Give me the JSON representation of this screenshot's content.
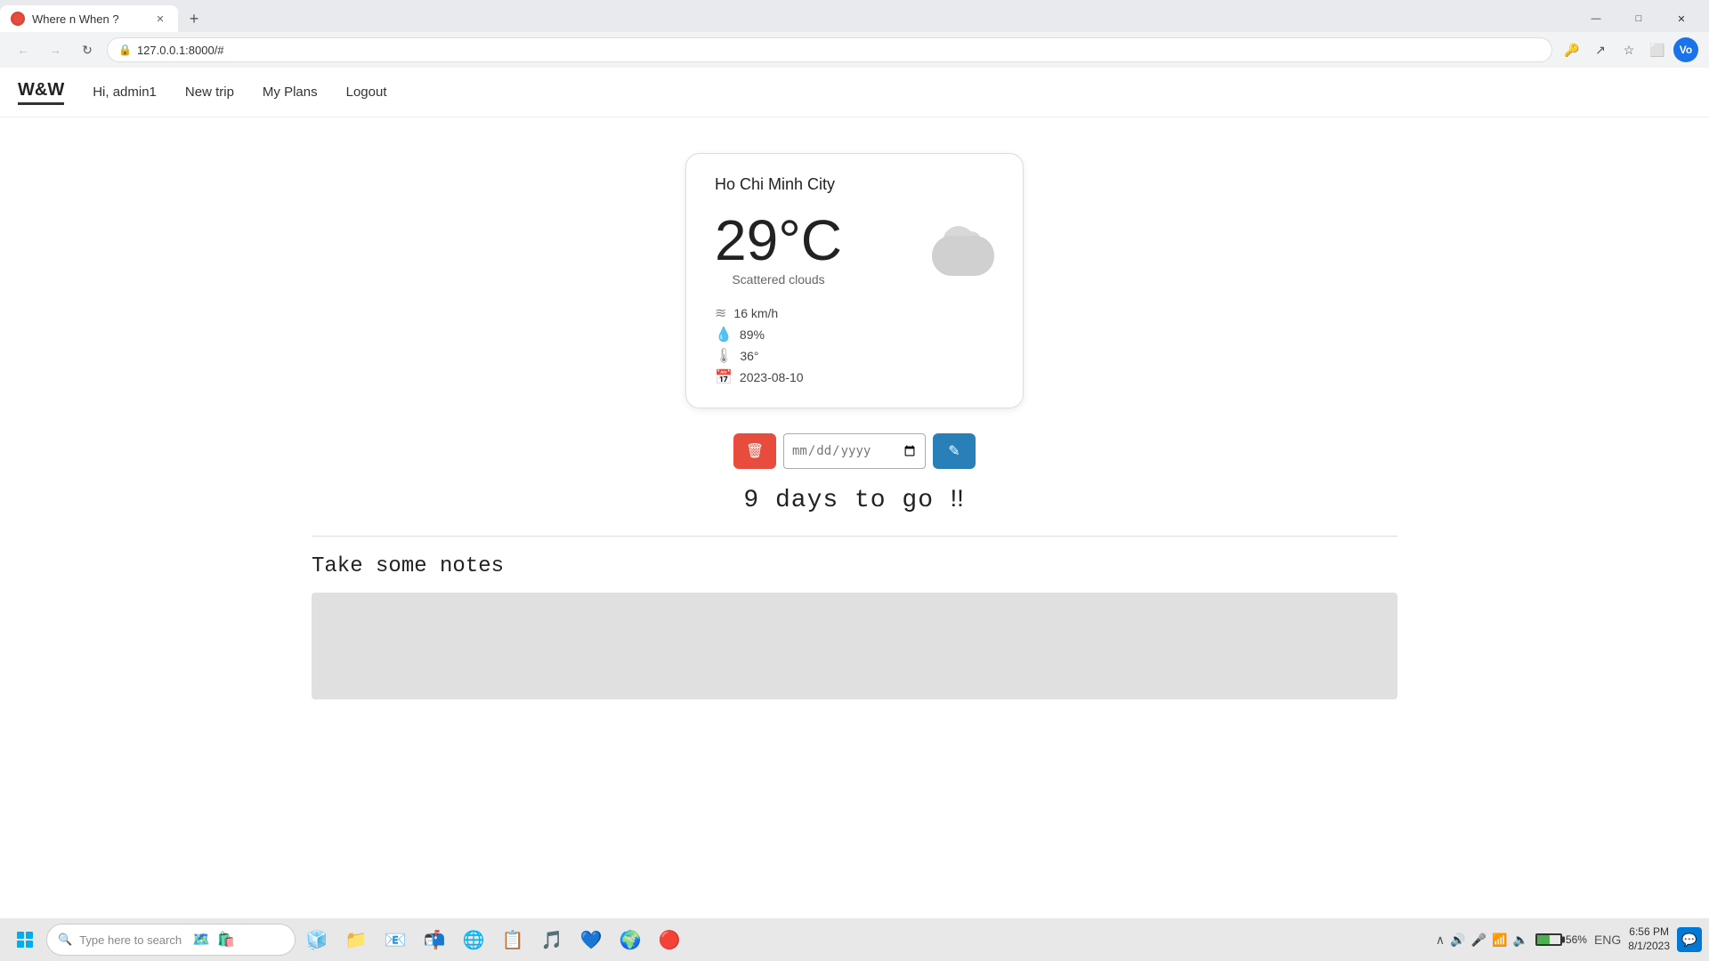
{
  "browser": {
    "tab_title": "Where n When ?",
    "url": "127.0.0.1:8000/#",
    "favicon": "🌐"
  },
  "navbar": {
    "brand": "W&W",
    "greeting": "Hi, admin1",
    "new_trip": "New trip",
    "my_plans": "My Plans",
    "logout": "Logout"
  },
  "weather": {
    "city": "Ho Chi Minh City",
    "temperature": "29°C",
    "description": "Scattered clouds",
    "wind": "16 km/h",
    "humidity": "89%",
    "feel": "36°",
    "date": "2023-08-10"
  },
  "controls": {
    "date_placeholder": "mm/dd/yyyy"
  },
  "countdown": "9 days to go ‼",
  "notes": {
    "title": "Take some notes",
    "placeholder": ""
  },
  "taskbar": {
    "search_placeholder": "Type here to search",
    "time": "6:56 PM",
    "date": "8/1/2023",
    "battery_percent": "56%",
    "language": "ENG"
  },
  "icons": {
    "back": "←",
    "forward": "→",
    "refresh": "↻",
    "lock": "🔒",
    "star": "☆",
    "menu": "⋮",
    "profile": "Vo",
    "sidebar": "⬜",
    "minimize": "—",
    "maximize": "□",
    "close": "✕",
    "delete": "🗑",
    "edit": "✎",
    "search": "🔍",
    "wind": "≋",
    "humidity": "💧",
    "thermometer": "🌡",
    "calendar": "📅"
  }
}
